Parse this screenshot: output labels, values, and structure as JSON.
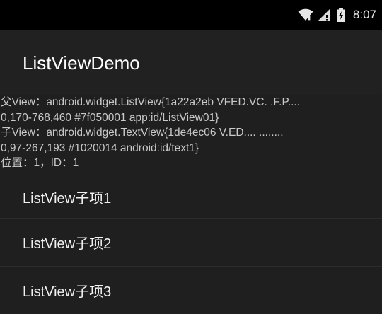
{
  "status_bar": {
    "time": "8:07",
    "icons": [
      "wifi-icon",
      "signal-icon",
      "battery-icon"
    ]
  },
  "app": {
    "title": "ListViewDemo"
  },
  "log": {
    "lines": [
      "父View：android.widget.ListView{1a22a2eb VFED.VC. .F.P....",
      "0,170-768,460 #7f050001 app:id/ListView01}",
      "子View：android.widget.TextView{1de4ec06 V.ED.... ........",
      "0,97-267,193 #1020014 android:id/text1}",
      "位置：1，ID：1"
    ]
  },
  "list": {
    "items": [
      {
        "label": "ListView子项1"
      },
      {
        "label": "ListView子项2"
      },
      {
        "label": "ListView子项3"
      }
    ]
  },
  "colors": {
    "status_bar_bg": "#000000",
    "background": "#1f1f1f",
    "title_text": "#ffffff",
    "log_text": "#c9c9c9",
    "item_text": "#f2f2f2",
    "divider": "#2c2c2c"
  }
}
